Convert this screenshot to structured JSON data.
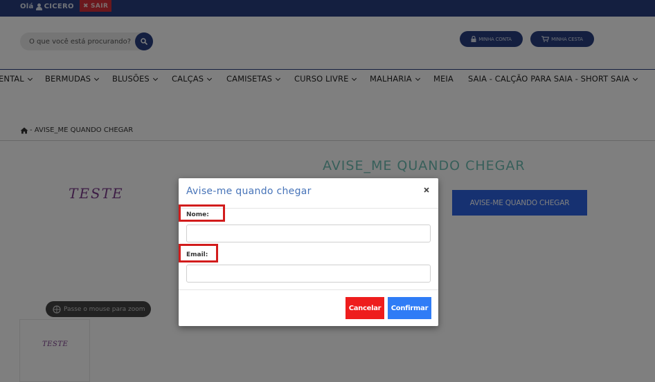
{
  "topbar": {
    "greeting": "Olá",
    "username": "CICERO",
    "logout_label": "SAIR"
  },
  "header": {
    "search_placeholder": "O que você está procurando?",
    "account_label": "MINHA CONTA",
    "cart_label": "MINHA CESTA"
  },
  "nav": {
    "items": [
      {
        "label": "ENTAL",
        "has_dropdown": true
      },
      {
        "label": "BERMUDAS",
        "has_dropdown": true
      },
      {
        "label": "BLUSÕES",
        "has_dropdown": true
      },
      {
        "label": "CALÇAS",
        "has_dropdown": true
      },
      {
        "label": "CAMISETAS",
        "has_dropdown": true
      },
      {
        "label": "CURSO LIVRE",
        "has_dropdown": true
      },
      {
        "label": "MALHARIA",
        "has_dropdown": true
      },
      {
        "label": "MEIA",
        "has_dropdown": false
      },
      {
        "label": "SAIA - CALÇÃO PARA SAIA - SHORT SAIA",
        "has_dropdown": true
      }
    ]
  },
  "breadcrumb": {
    "text": "- AVISE_ME QUANDO CHEGAR"
  },
  "product": {
    "title": "AVISE_ME QUANDO CHEGAR",
    "notify_button_label": "AVISE-ME QUANDO CHEGAR",
    "image_text": "TESTE",
    "thumb_text": "TESTE",
    "zoom_hint": "Passe o mouse para zoom"
  },
  "modal": {
    "title": "Avise-me quando chegar",
    "close_symbol": "×",
    "name_label": "Nome:",
    "name_value": "",
    "email_label": "Email:",
    "email_value": "",
    "cancel_label": "Cancelar",
    "confirm_label": "Confirmar"
  },
  "colors": {
    "brand_navy": "#283f80",
    "teal_title": "#6fbfb4",
    "primary_blue": "#2d63e2",
    "cancel_red": "#ee1d1d",
    "confirm_blue": "#2f7cf6",
    "highlight_red": "#d21c1c"
  }
}
